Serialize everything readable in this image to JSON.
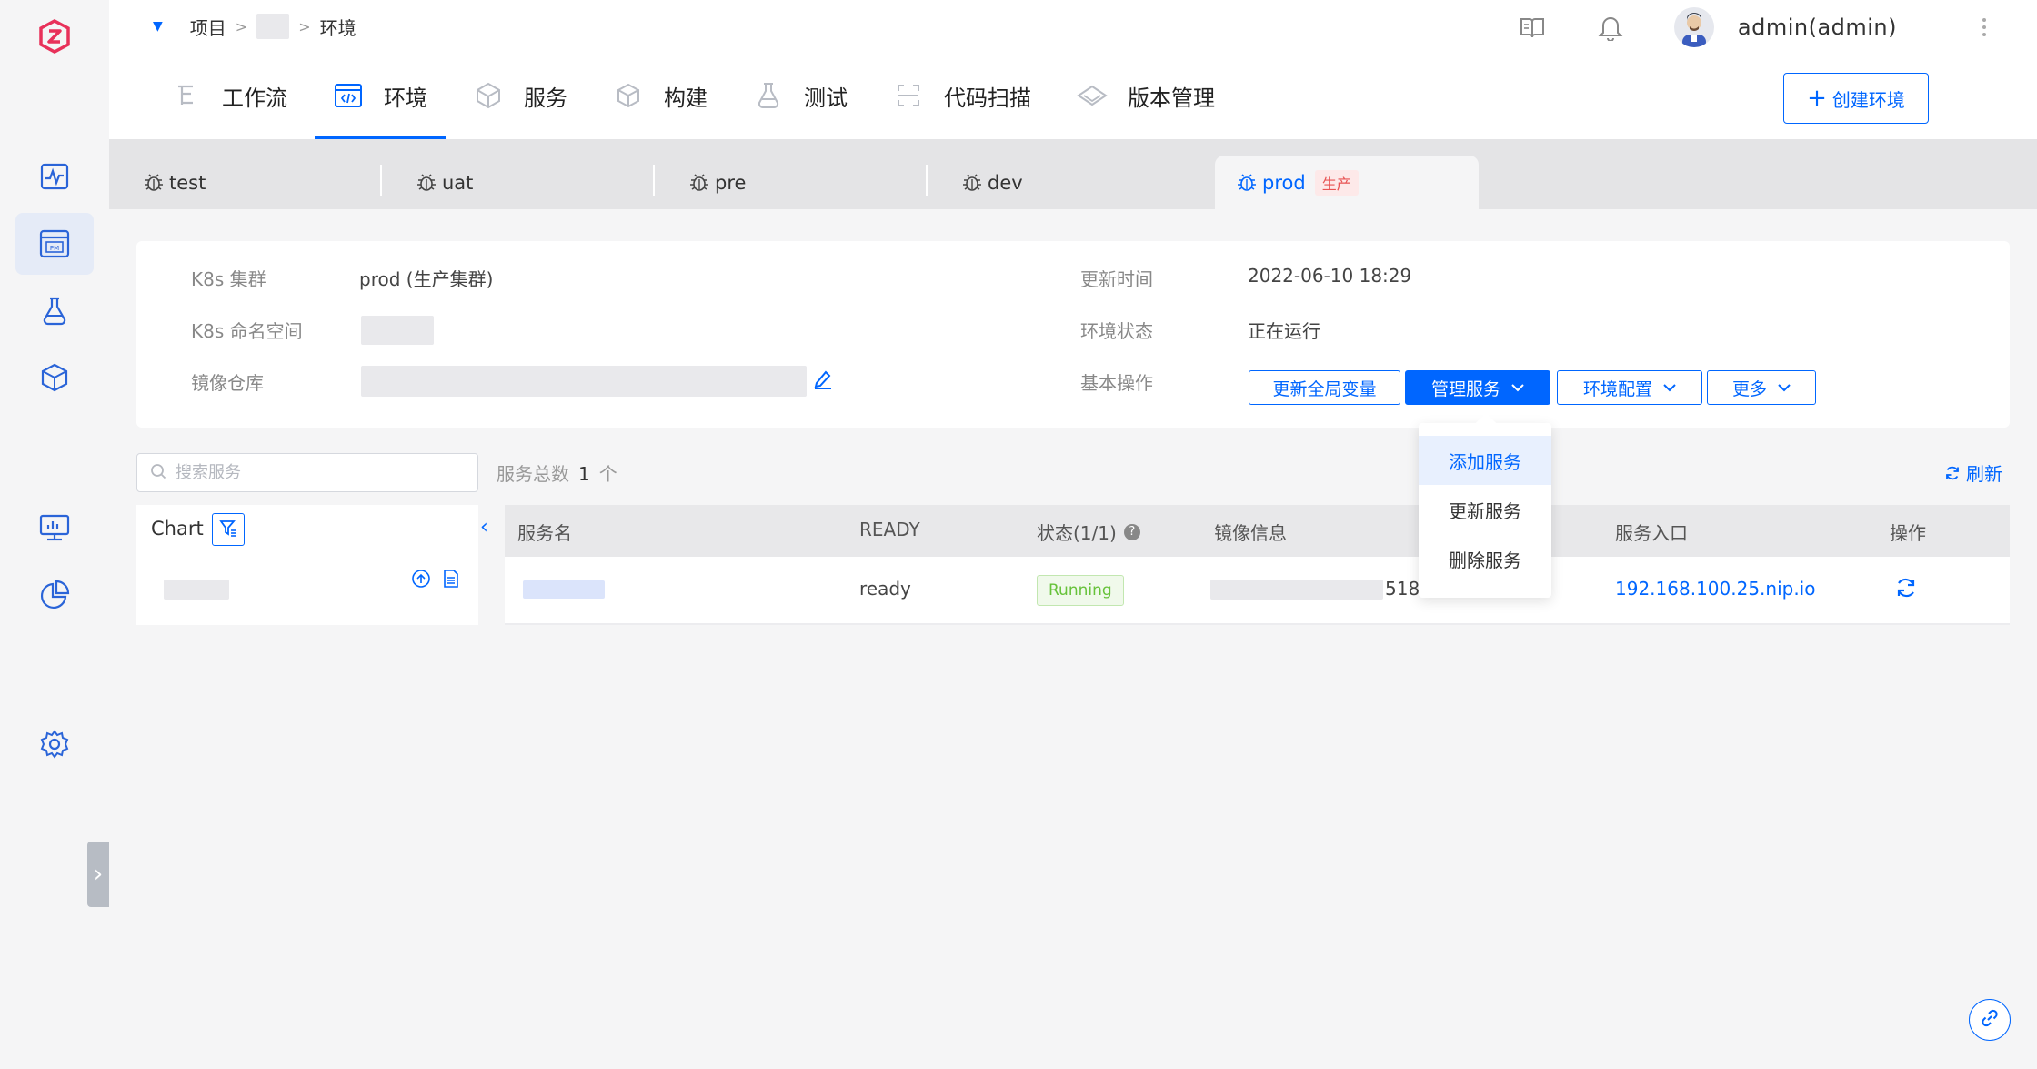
{
  "breadcrumb": {
    "project": "项目",
    "env": "环境"
  },
  "user": {
    "name": "admin(admin)"
  },
  "tabs": [
    {
      "label": "工作流",
      "icon": "workflow-icon"
    },
    {
      "label": "环境",
      "icon": "environment-icon",
      "active": true
    },
    {
      "label": "服务",
      "icon": "service-icon"
    },
    {
      "label": "构建",
      "icon": "build-icon"
    },
    {
      "label": "测试",
      "icon": "test-flask-icon"
    },
    {
      "label": "代码扫描",
      "icon": "code-scan-icon"
    },
    {
      "label": "版本管理",
      "icon": "version-icon"
    }
  ],
  "create_env_label": "创建环境",
  "env_tabs": [
    {
      "label": "test"
    },
    {
      "label": "uat"
    },
    {
      "label": "pre"
    },
    {
      "label": "dev"
    },
    {
      "label": "prod",
      "badge": "生产",
      "active": true
    }
  ],
  "info": {
    "cluster_label": "K8s 集群",
    "cluster_value": "prod (生产集群)",
    "namespace_label": "K8s 命名空间",
    "registry_label": "镜像仓库",
    "update_time_label": "更新时间",
    "update_time_value": "2022-06-10 18:29",
    "status_label": "环境状态",
    "status_value": "正在运行",
    "ops_label": "基本操作"
  },
  "ops": {
    "update_vars": "更新全局变量",
    "manage_services": "管理服务",
    "env_config": "环境配置",
    "more": "更多"
  },
  "dropdown": [
    "添加服务",
    "更新服务",
    "删除服务"
  ],
  "search": {
    "placeholder": "搜索服务"
  },
  "total": {
    "label": "服务总数",
    "count": "1",
    "unit": "个"
  },
  "refresh_label": "刷新",
  "chart_panel": {
    "title": "Chart"
  },
  "table": {
    "headers": {
      "name": "服务名",
      "ready": "READY",
      "status": "状态(1/1)",
      "image": "镜像信息",
      "entry": "服务入口",
      "ops": "操作"
    },
    "rows": [
      {
        "ready": "ready",
        "status": "Running",
        "image_suffix": "518",
        "entry": "192.168.100.25.nip.io"
      }
    ]
  },
  "colors": {
    "primary": "#0066ff",
    "running": "#67c23a",
    "prod_badge": "#e85353"
  }
}
